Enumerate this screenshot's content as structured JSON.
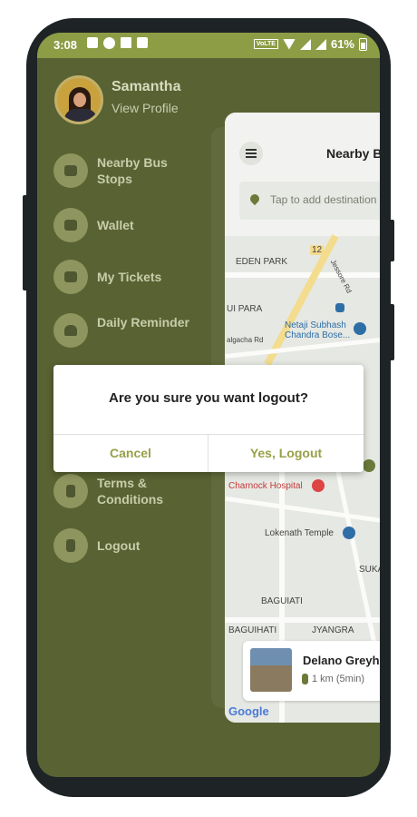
{
  "status_bar": {
    "time": "3:08",
    "network_badge": "VoLTE",
    "battery": "61%"
  },
  "profile": {
    "name": "Samantha",
    "link": "View Profile"
  },
  "menu": {
    "items": [
      {
        "label": "Nearby Bus Stops",
        "icon": "bus-stop-icon"
      },
      {
        "label": "Wallet",
        "icon": "wallet-icon"
      },
      {
        "label": "My Tickets",
        "icon": "ticket-icon"
      },
      {
        "label": "Daily Reminder",
        "icon": "bell-icon"
      },
      {
        "label": "Terms & Conditions",
        "icon": "document-icon"
      },
      {
        "label": "Logout",
        "icon": "logout-icon"
      }
    ]
  },
  "map_screen": {
    "title": "Nearby Bus Stops",
    "search_placeholder": "Tap to add destination",
    "places": {
      "eden_park": "EDEN PARK",
      "ui_para": "UI PARA",
      "airport": "Netaji Subhash Chandra Bose...",
      "jessore_rd": "Jessore Rd",
      "route_12": "12",
      "algacha_rd": "algacha Rd",
      "hospital": "Charnock Hospital",
      "temple": "Lokenath Temple",
      "baguiati": "BAGUIATI",
      "baguihati": "BAGUIHATI",
      "jyangra": "JYANGRA",
      "suka": "SUKA"
    },
    "bus_stop": {
      "name": "Delano Greyhound",
      "distance": "1 km (5min)"
    },
    "attribution": "Google"
  },
  "dialog": {
    "message": "Are you sure you want logout?",
    "cancel_label": "Cancel",
    "confirm_label": "Yes, Logout"
  },
  "colors": {
    "drawer_bg": "#596232",
    "status_bar": "#8c9d46",
    "accent": "#98a048"
  }
}
